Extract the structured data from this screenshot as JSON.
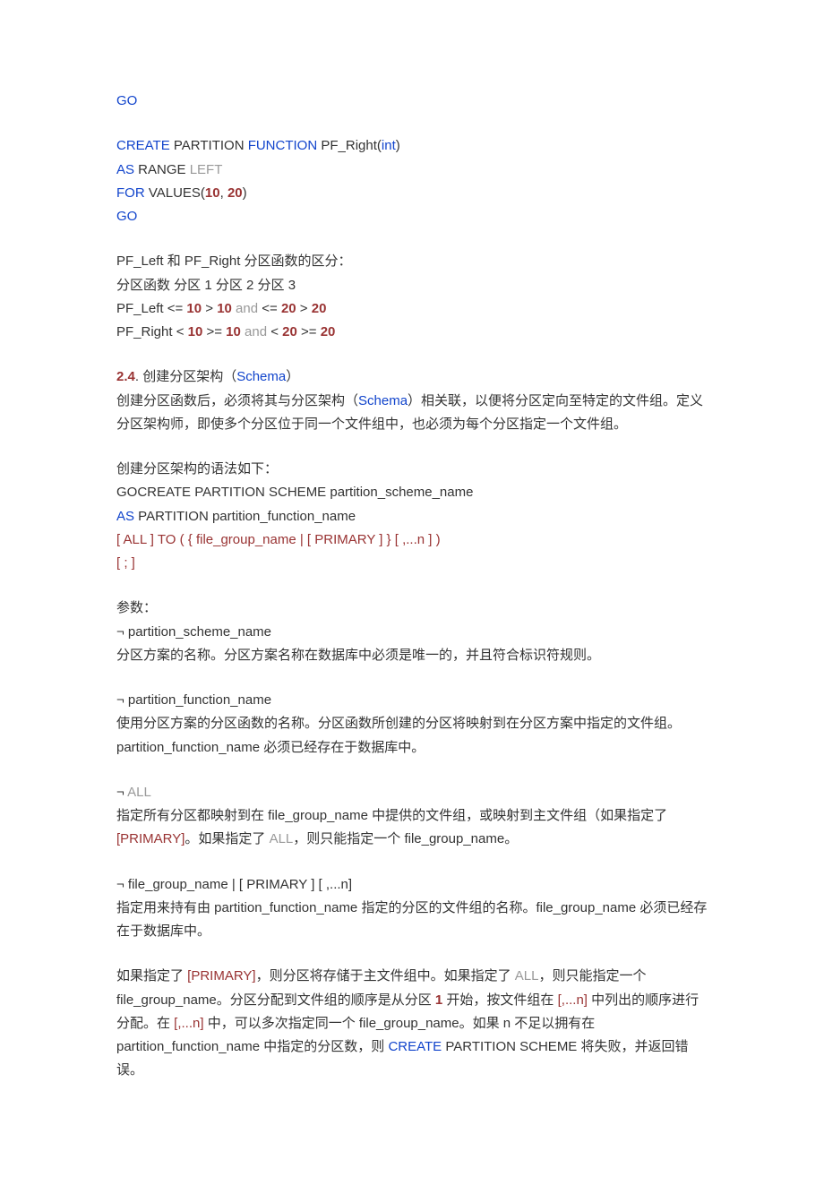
{
  "l1": "GO",
  "code2_l1_create": "CREATE",
  "code2_l1_mid": " PARTITION ",
  "code2_l1_func": "FUNCTION",
  "code2_l1_rest": " PF_Right(",
  "code2_l1_int": "int",
  "code2_l1_paren": ")",
  "code2_l2_as": "AS",
  "code2_l2_range": " RANGE ",
  "code2_l2_left": "LEFT",
  "code2_l3_for": "FOR",
  "code2_l3_values": " VALUES(",
  "code2_l3_10": "10",
  "code2_l3_comma": ", ",
  "code2_l3_20": "20",
  "code2_l3_paren": ")",
  "code2_l4": "GO",
  "diff_l1": "PF_Left 和 PF_Right 分区函数的区分：",
  "diff_l2": "分区函数 分区 1 分区 2 分区 3",
  "diff_l3_a": "PF_Left <= ",
  "diff_l3_b10": "10",
  "diff_l3_c": " > ",
  "diff_l3_d10": "10",
  "diff_l3_and": " and ",
  "diff_l3_e": "<= ",
  "diff_l3_f20": "20",
  "diff_l3_g": " > ",
  "diff_l3_h20": "20",
  "diff_l4_a": "PF_Right < ",
  "diff_l4_b10": "10",
  "diff_l4_c": " >= ",
  "diff_l4_d10": "10",
  "diff_l4_and": " and ",
  "diff_l4_e": "< ",
  "diff_l4_f20": "20",
  "diff_l4_g": " >= ",
  "diff_l4_h20": "20",
  "s24_num": "2.4",
  "s24_title_a": ". 创建分区架构（",
  "s24_title_b": "Schema",
  "s24_title_c": "）",
  "s24_p1_a": "创建分区函数后，必须将其与分区架构（",
  "s24_p1_b": "Schema",
  "s24_p1_c": "）相关联，以便将分区定向至特定的文件组。定义分区架构师，即使多个分区位于同一个文件组中，也必须为每个分区指定一个文件组。",
  "syntax_intro": "创建分区架构的语法如下：",
  "syntax_l1": "GOCREATE PARTITION SCHEME partition_scheme_name",
  "syntax_l2_as": "AS",
  "syntax_l2_rest": " PARTITION partition_function_name",
  "syntax_l3": "[ ALL ] TO ( { file_group_name | [ PRIMARY ] } [ ,...n ] )",
  "syntax_l4": "[ ; ]",
  "params_title": "参数：",
  "p1_head": "¬ partition_scheme_name",
  "p1_body": "分区方案的名称。分区方案名称在数据库中必须是唯一的，并且符合标识符规则。",
  "p2_head": "¬ partition_function_name",
  "p2_body": "使用分区方案的分区函数的名称。分区函数所创建的分区将映射到在分区方案中指定的文件组。partition_function_name 必须已经存在于数据库中。",
  "p3_head_neg": "¬ ",
  "p3_head_all": "ALL",
  "p3_body_a": "指定所有分区都映射到在 file_group_name 中提供的文件组，或映射到主文件组（如果指定了 ",
  "p3_body_b": "[PRIMARY]",
  "p3_body_c": "。如果指定了 ",
  "p3_body_d": "ALL",
  "p3_body_e": "，则只能指定一个 file_group_name。",
  "p4_head": "¬ file_group_name | [ PRIMARY ] [ ,...n]",
  "p4_body": "指定用来持有由 partition_function_name 指定的分区的文件组的名称。file_group_name 必须已经存在于数据库中。",
  "p5_a": "如果指定了 ",
  "p5_b": "[PRIMARY]",
  "p5_c": "，则分区将存储于主文件组中。如果指定了 ",
  "p5_d": "ALL",
  "p5_e": "，则只能指定一个 file_group_name。分区分配到文件组的顺序是从分区 ",
  "p5_f": "1",
  "p5_g": " 开始，按文件组在 ",
  "p5_h": "[,...n]",
  "p5_i": " 中列出的顺序进行分配。在 ",
  "p5_j": "[,...n]",
  "p5_k": " 中，可以多次指定同一个 file_group_name。如果 n 不足以拥有在 partition_function_name 中指定的分区数，则 ",
  "p5_l": "CREATE",
  "p5_m": " PARTITION SCHEME 将失败，并返回错误。"
}
